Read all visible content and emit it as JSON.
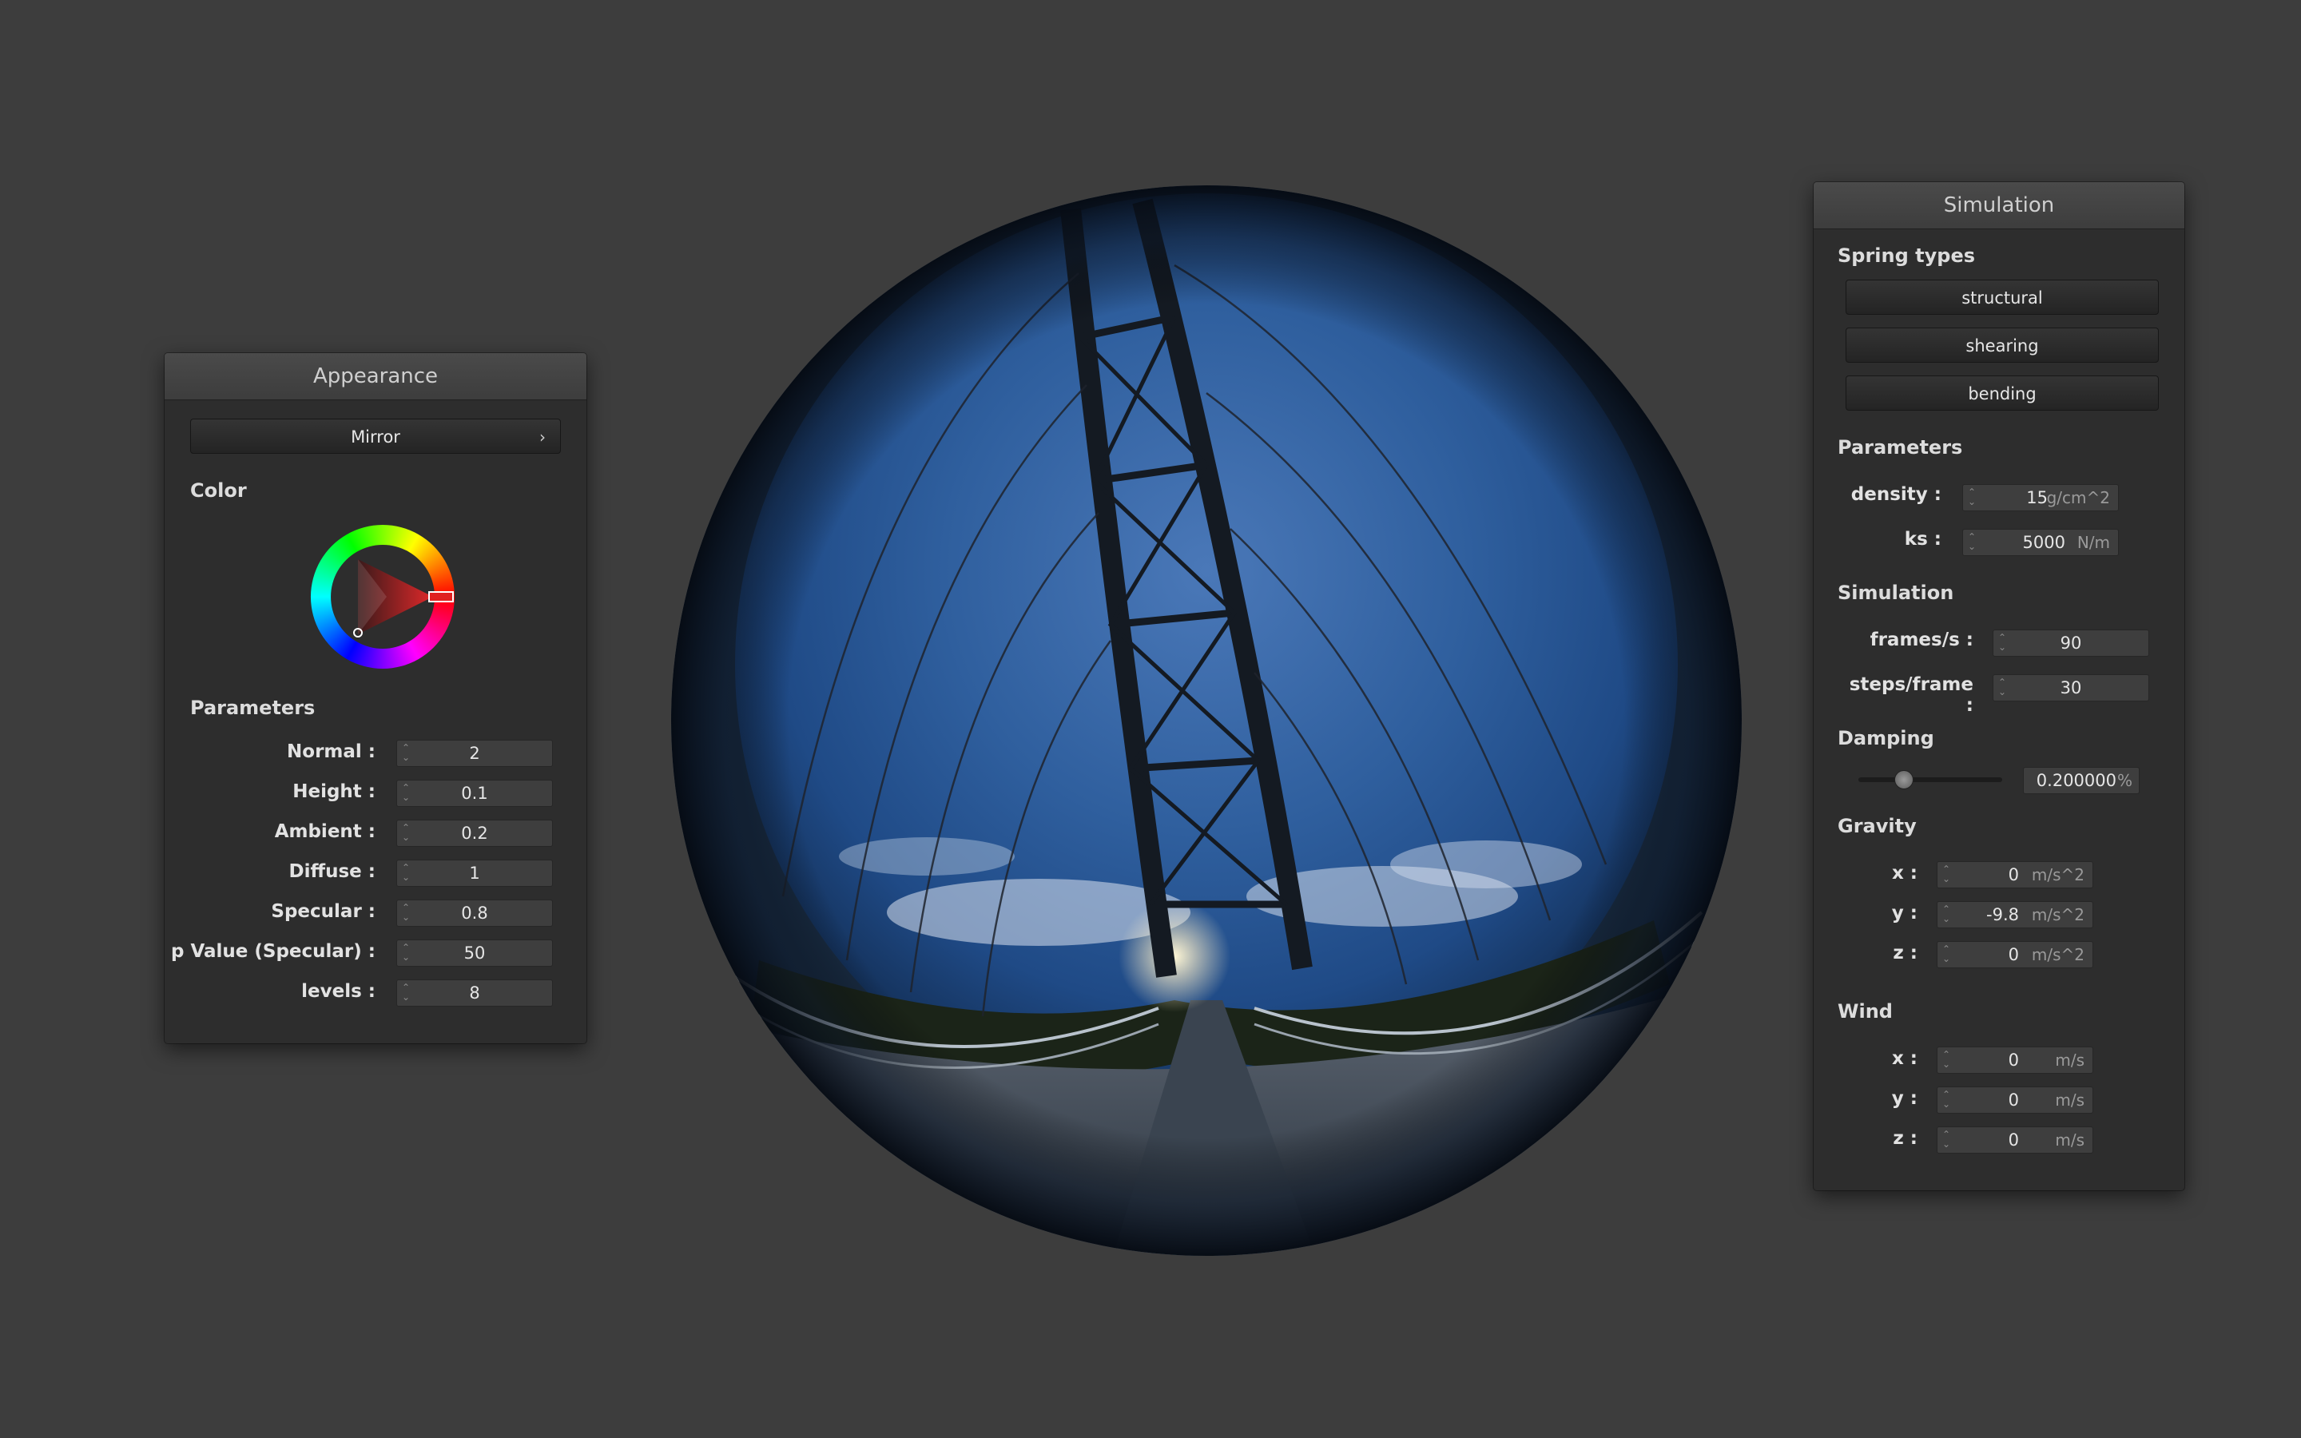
{
  "appearance": {
    "title": "Appearance",
    "material": "Mirror",
    "color_label": "Color",
    "parameters_label": "Parameters",
    "params": [
      {
        "label": "Normal :",
        "value": "2"
      },
      {
        "label": "Height :",
        "value": "0.1"
      },
      {
        "label": "Ambient :",
        "value": "0.2"
      },
      {
        "label": "Diffuse :",
        "value": "1"
      },
      {
        "label": "Specular :",
        "value": "0.8"
      },
      {
        "label": "p Value (Specular) :",
        "value": "50"
      },
      {
        "label": "levels :",
        "value": "8"
      }
    ]
  },
  "simulation": {
    "title": "Simulation",
    "spring_types_label": "Spring types",
    "spring_types": [
      "structural",
      "shearing",
      "bending"
    ],
    "parameters_label": "Parameters",
    "density": {
      "label": "density :",
      "value": "15",
      "unit": "g/cm^2"
    },
    "ks": {
      "label": "ks :",
      "value": "5000",
      "unit": "N/m"
    },
    "simulation_label": "Simulation",
    "frames": {
      "label": "frames/s :",
      "value": "90"
    },
    "steps": {
      "label": "steps/frame :",
      "value": "30"
    },
    "damping_label": "Damping",
    "damping": {
      "value": "0.200000",
      "unit": "%",
      "slider_fraction": 0.2
    },
    "gravity_label": "Gravity",
    "gravity": [
      {
        "label": "x :",
        "value": "0",
        "unit": "m/s^2"
      },
      {
        "label": "y :",
        "value": "-9.8",
        "unit": "m/s^2"
      },
      {
        "label": "z :",
        "value": "0",
        "unit": "m/s^2"
      }
    ],
    "wind_label": "Wind",
    "wind": [
      {
        "label": "x :",
        "value": "0",
        "unit": "m/s"
      },
      {
        "label": "y :",
        "value": "0",
        "unit": "m/s"
      },
      {
        "label": "z :",
        "value": "0",
        "unit": "m/s"
      }
    ]
  }
}
